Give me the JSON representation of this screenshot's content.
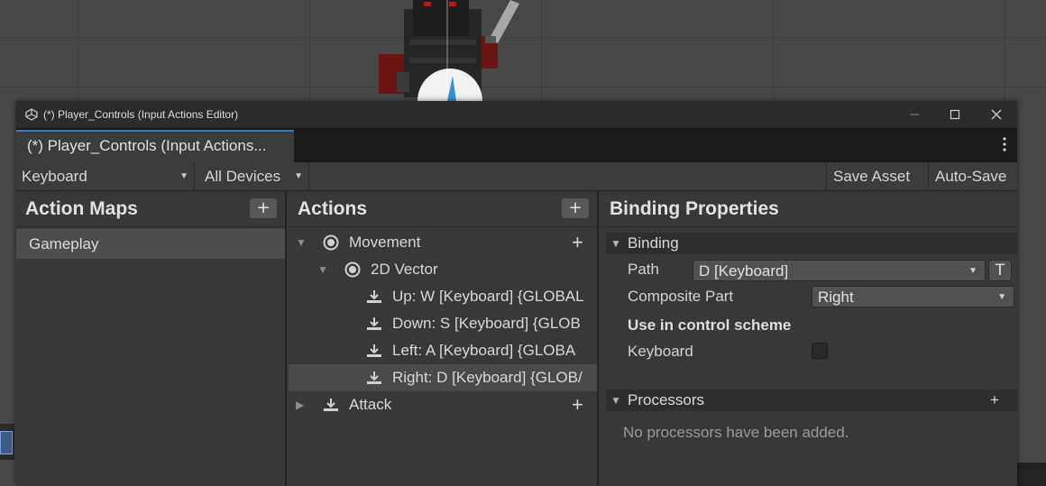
{
  "window": {
    "title": "(*) Player_Controls (Input Actions Editor)",
    "tab_title": "(*) Player_Controls (Input Actions...",
    "minimize": "—",
    "maximize": "☐",
    "close": "✕"
  },
  "toolbar": {
    "control_scheme": "Keyboard",
    "devices": "All Devices",
    "save_asset": "Save Asset",
    "auto_save": "Auto-Save"
  },
  "action_maps": {
    "header": "Action Maps",
    "add": "+",
    "items": [
      "Gameplay"
    ]
  },
  "actions": {
    "header": "Actions",
    "add": "+",
    "tree": [
      {
        "label": "Movement",
        "kind": "action",
        "expanded": true
      },
      {
        "label": "2D Vector",
        "kind": "composite",
        "expanded": true
      },
      {
        "label": "Up: W [Keyboard] {GLOBAL",
        "kind": "binding"
      },
      {
        "label": "Down: S [Keyboard] {GLOB",
        "kind": "binding"
      },
      {
        "label": "Left: A [Keyboard] {GLOBA",
        "kind": "binding"
      },
      {
        "label": "Right: D [Keyboard] {GLOB/",
        "kind": "binding",
        "selected": true
      },
      {
        "label": "Attack",
        "kind": "action",
        "expanded": false
      }
    ],
    "row_add": "+"
  },
  "binding_properties": {
    "header": "Binding Properties",
    "binding_section": "Binding",
    "path_label": "Path",
    "path_value": "D [Keyboard]",
    "t_button": "T",
    "composite_part_label": "Composite Part",
    "composite_part_value": "Right",
    "use_in_control_scheme": "Use in control scheme",
    "scheme_keyboard_label": "Keyboard",
    "scheme_keyboard_checked": false,
    "processors_section": "Processors",
    "processors_add": "+",
    "processors_empty": "No processors have been added."
  },
  "colors": {
    "accent_tab": "#3a79bb",
    "panel_bg": "#383838",
    "selected_row": "#4a4a4a"
  }
}
